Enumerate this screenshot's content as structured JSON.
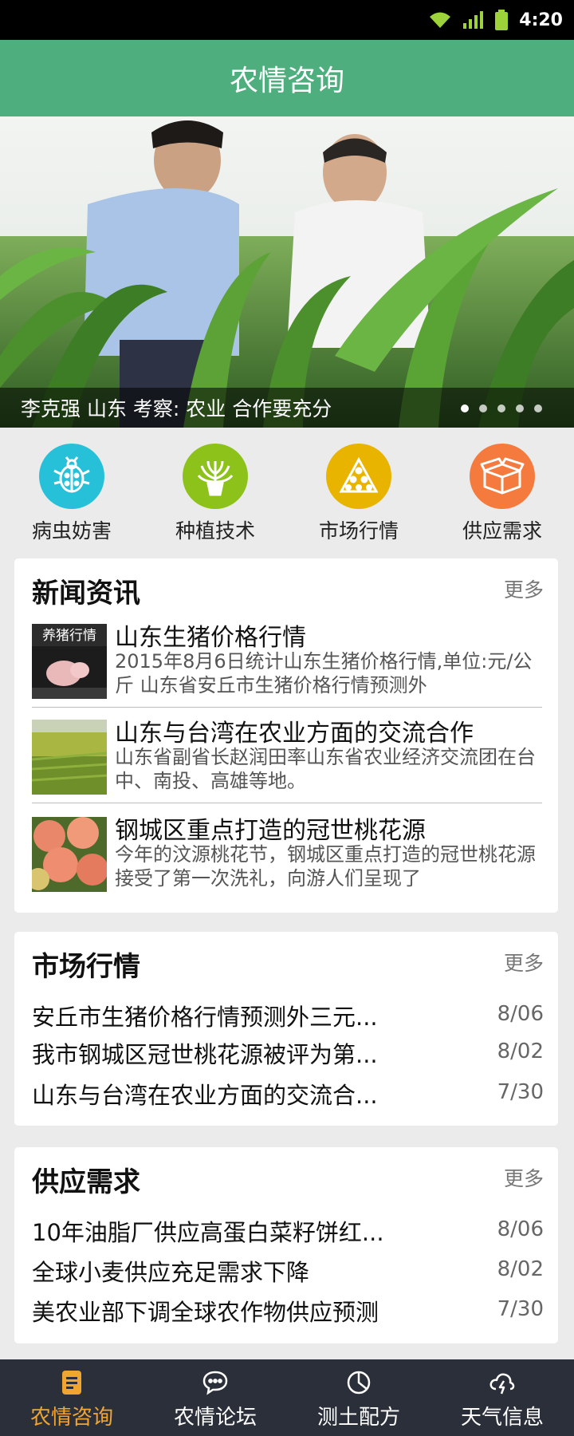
{
  "status_bar": {
    "time": "4:20"
  },
  "app_bar": {
    "title": "农情咨询"
  },
  "banner": {
    "caption": "李克强 山东 考察: 农业 合作要充分",
    "slide_count": 5,
    "active_slide": 1
  },
  "categories": [
    {
      "label": "病虫妨害",
      "icon": "ladybug-icon",
      "color": "#26c1d9"
    },
    {
      "label": "种植技术",
      "icon": "plant-icon",
      "color": "#8cc21a"
    },
    {
      "label": "市场行情",
      "icon": "market-icon",
      "color": "#e8b400"
    },
    {
      "label": "供应需求",
      "icon": "box-icon",
      "color": "#f57a3d"
    }
  ],
  "news": {
    "title": "新闻资讯",
    "more": "更多",
    "items": [
      {
        "title": "山东生猪价格行情",
        "snippet": "2015年8月6日统计山东生猪价格行情,单位:元/公斤 山东省安丘市生猪价格行情预测外",
        "thumb_text": "养猪行情"
      },
      {
        "title": "山东与台湾在农业方面的交流合作",
        "snippet": "山东省副省长赵润田率山东省农业经济交流团在台中、南投、高雄等地。"
      },
      {
        "title": "钢城区重点打造的冠世桃花源",
        "snippet": "今年的汶源桃花节，钢城区重点打造的冠世桃花源接受了第一次洗礼，向游人们呈现了"
      }
    ]
  },
  "market": {
    "title": "市场行情",
    "more": "更多",
    "items": [
      {
        "title": "安丘市生猪价格行情预测外三元...",
        "date": "8/06"
      },
      {
        "title": "我市钢城区冠世桃花源被评为第...",
        "date": "8/02"
      },
      {
        "title": "山东与台湾在农业方面的交流合...",
        "date": "7/30"
      }
    ]
  },
  "supply": {
    "title": "供应需求",
    "more": "更多",
    "items": [
      {
        "title": "10年油脂厂供应高蛋白菜籽饼红...",
        "date": "8/06"
      },
      {
        "title": "全球小麦供应充足需求下降",
        "date": "8/02"
      },
      {
        "title": "美农业部下调全球农作物供应预测",
        "date": "7/30"
      }
    ]
  },
  "bottom_nav": [
    {
      "label": "农情咨询",
      "icon": "document-icon",
      "active": true
    },
    {
      "label": "农情论坛",
      "icon": "chat-icon",
      "active": false
    },
    {
      "label": "测土配方",
      "icon": "pie-icon",
      "active": false
    },
    {
      "label": "天气信息",
      "icon": "cloud-bolt-icon",
      "active": false
    }
  ],
  "colors": {
    "app_bar": "#4fae7e",
    "nav_bg": "#2b2f3a",
    "nav_active": "#f0a530"
  }
}
